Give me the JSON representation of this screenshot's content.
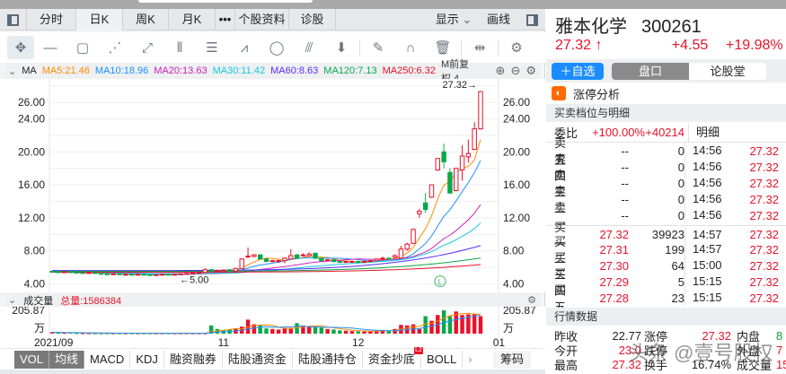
{
  "tabs": [
    "分时",
    "日K",
    "周K",
    "月K",
    "•••",
    "个股资料",
    "诊股"
  ],
  "tabs_right": {
    "display": "显示",
    "draw": "画线"
  },
  "active_tab": "日K",
  "ma_legend": {
    "label": "MA",
    "items": [
      {
        "text": "MA5:21.46",
        "color": "#ff8a00"
      },
      {
        "text": "MA10:18.96",
        "color": "#1e90ff"
      },
      {
        "text": "MA20:13.63",
        "color": "#d01fb8"
      },
      {
        "text": "MA30:11.42",
        "color": "#18c8e0"
      },
      {
        "text": "MA60:8.63",
        "color": "#5a2cff"
      },
      {
        "text": "MA120:7.13",
        "color": "#0aa84a"
      },
      {
        "text": "MA250:6.32",
        "color": "#e8122a"
      }
    ],
    "overlap": "M前复权.4"
  },
  "chart_data": {
    "type": "candlestick",
    "price_axis": {
      "ticks": [
        "4.00",
        "8.00",
        "12.00",
        "16.00",
        "20.00",
        "24.00",
        "26.00"
      ],
      "range": [
        3.6,
        28.2
      ]
    },
    "annotations": {
      "high": "27.32→",
      "low": "←5.00"
    },
    "x_labels": [
      {
        "text": "2021/09",
        "index": 0
      },
      {
        "text": "11",
        "index": 28
      },
      {
        "text": "12",
        "index": 50
      },
      {
        "text": "01",
        "index": 73
      }
    ],
    "ohlc": [
      [
        5.5,
        5.6,
        5.4,
        5.45
      ],
      [
        5.45,
        5.5,
        5.3,
        5.35
      ],
      [
        5.35,
        5.5,
        5.3,
        5.45
      ],
      [
        5.45,
        5.5,
        5.35,
        5.4
      ],
      [
        5.4,
        5.45,
        5.3,
        5.35
      ],
      [
        5.35,
        5.4,
        5.2,
        5.25
      ],
      [
        5.25,
        5.4,
        5.2,
        5.35
      ],
      [
        5.35,
        5.4,
        5.2,
        5.25
      ],
      [
        5.25,
        5.3,
        5.15,
        5.2
      ],
      [
        5.2,
        5.3,
        5.1,
        5.15
      ],
      [
        5.15,
        5.25,
        5.1,
        5.2
      ],
      [
        5.2,
        5.25,
        5.05,
        5.1
      ],
      [
        5.1,
        5.2,
        5.0,
        5.15
      ],
      [
        5.15,
        5.2,
        5.0,
        5.05
      ],
      [
        5.05,
        5.2,
        5.0,
        5.15
      ],
      [
        5.15,
        5.25,
        5.0,
        5.1
      ],
      [
        5.1,
        5.2,
        5.0,
        5.05
      ],
      [
        5.05,
        5.15,
        5.0,
        5.1
      ],
      [
        5.1,
        5.2,
        5.05,
        5.15
      ],
      [
        5.15,
        5.25,
        5.05,
        5.1
      ],
      [
        5.1,
        5.2,
        5.05,
        5.15
      ],
      [
        5.15,
        5.25,
        5.1,
        5.2
      ],
      [
        5.2,
        5.3,
        5.15,
        5.25
      ],
      [
        5.25,
        5.35,
        5.2,
        5.3
      ],
      [
        5.3,
        5.45,
        5.25,
        5.4
      ],
      [
        5.4,
        5.9,
        5.35,
        5.7
      ],
      [
        5.7,
        5.8,
        5.5,
        5.55
      ],
      [
        5.55,
        5.7,
        5.45,
        5.6
      ],
      [
        5.6,
        5.75,
        5.5,
        5.65
      ],
      [
        5.7,
        5.8,
        5.5,
        5.55
      ],
      [
        5.55,
        5.9,
        5.5,
        5.85
      ],
      [
        5.85,
        7.1,
        5.8,
        7.0
      ],
      [
        7.3,
        8.4,
        7.1,
        7.35
      ],
      [
        7.3,
        7.6,
        7.2,
        7.5
      ],
      [
        7.5,
        7.55,
        6.9,
        7.0
      ],
      [
        7.0,
        7.1,
        6.6,
        6.7
      ],
      [
        6.7,
        6.9,
        6.6,
        6.8
      ],
      [
        6.7,
        6.9,
        6.5,
        6.8
      ],
      [
        6.8,
        7.2,
        6.5,
        7.1
      ],
      [
        7.0,
        8.2,
        6.9,
        7.4
      ],
      [
        7.5,
        7.6,
        7.0,
        7.1
      ],
      [
        7.4,
        7.7,
        7.3,
        7.5
      ],
      [
        7.4,
        7.8,
        7.3,
        7.6
      ],
      [
        7.7,
        7.7,
        7.0,
        7.1
      ],
      [
        7.1,
        7.2,
        6.7,
        6.8
      ],
      [
        6.8,
        7.0,
        6.7,
        6.9
      ],
      [
        6.9,
        7.0,
        6.6,
        6.7
      ],
      [
        6.7,
        6.8,
        6.5,
        6.6
      ],
      [
        6.6,
        6.8,
        6.5,
        6.7
      ],
      [
        6.7,
        6.8,
        6.6,
        6.7
      ],
      [
        6.7,
        6.8,
        6.5,
        6.6
      ],
      [
        6.6,
        6.8,
        6.5,
        6.7
      ],
      [
        6.7,
        6.9,
        6.6,
        6.8
      ],
      [
        6.8,
        7.1,
        6.7,
        7.0
      ],
      [
        7.0,
        7.3,
        6.8,
        7.1
      ],
      [
        7.1,
        7.2,
        6.9,
        7.0
      ],
      [
        7.2,
        7.6,
        7.1,
        7.4
      ],
      [
        7.1,
        8.6,
        7.0,
        8.2
      ],
      [
        8.2,
        9.0,
        8.0,
        8.8
      ],
      [
        8.9,
        10.7,
        8.8,
        10.6
      ],
      [
        12.5,
        13.1,
        12.0,
        12.8
      ],
      [
        13.8,
        15.0,
        12.6,
        13.0
      ],
      [
        14.5,
        16.0,
        14.4,
        16.0
      ],
      [
        17.8,
        19.2,
        17.7,
        19.2
      ],
      [
        20.0,
        21.0,
        18.0,
        18.8
      ],
      [
        17.5,
        18.0,
        15.0,
        15.0
      ],
      [
        15.3,
        18.0,
        15.2,
        18.0
      ],
      [
        17.8,
        20.8,
        16.5,
        19.5
      ],
      [
        19.4,
        21.5,
        18.7,
        19.8
      ],
      [
        20.3,
        23.6,
        20.2,
        22.8
      ],
      [
        22.8,
        27.32,
        22.7,
        27.32
      ]
    ],
    "volume_unit": "万",
    "volume_max": "205.87",
    "volume": [
      12,
      10,
      6,
      8,
      5,
      4,
      4,
      3,
      3,
      3,
      3,
      3,
      3,
      3,
      3,
      3,
      3,
      3,
      3,
      3,
      3,
      3,
      3,
      3,
      3,
      3,
      70,
      40,
      30,
      35,
      40,
      60,
      120,
      80,
      70,
      45,
      40,
      35,
      45,
      50,
      90,
      70,
      60,
      60,
      55,
      40,
      35,
      28,
      25,
      22,
      20,
      18,
      20,
      25,
      30,
      25,
      40,
      75,
      70,
      80,
      40,
      150,
      110,
      160,
      200,
      150,
      190,
      160,
      165,
      170,
      150
    ],
    "volume_up": [
      1,
      0,
      1,
      0,
      0,
      1,
      1,
      0,
      0,
      0,
      1,
      0,
      1,
      0,
      1,
      0,
      0,
      1,
      1,
      0,
      1,
      1,
      1,
      1,
      1,
      1,
      0,
      0,
      0,
      0,
      1,
      1,
      1,
      1,
      0,
      0,
      1,
      1,
      1,
      1,
      0,
      1,
      1,
      0,
      0,
      1,
      0,
      0,
      1,
      1,
      0,
      1,
      1,
      1,
      1,
      0,
      1,
      1,
      1,
      1,
      1,
      0,
      1,
      1,
      0,
      0,
      1,
      1,
      1,
      1,
      1
    ]
  },
  "volume_header": {
    "label": "成交量",
    "total": "总量:1586384"
  },
  "bottom_tabs": [
    "VOL",
    "均线",
    "MACD",
    "KDJ",
    "融资融券",
    "陆股通资金",
    "陆股通持仓",
    "资金抄底",
    "BOLL"
  ],
  "bottom_badge": "L2",
  "chips_button": "筹码",
  "stock": {
    "name": "雅本化学",
    "code": "300261",
    "price": "27.32",
    "arrow": "↑",
    "change": "+4.55",
    "pct": "+19.98%"
  },
  "buttons": {
    "add": "＋自选",
    "seg_active": "盘口",
    "seg_other": "论股堂"
  },
  "limit_analysis": "涨停分析",
  "orderbook": {
    "title": "买卖档位与明细",
    "wb_label": "委比",
    "wb_pct": "+100.00%",
    "wb_diff": "+40214",
    "detail_label": "明细",
    "sells": [
      {
        "l": "卖五",
        "p": "--",
        "v": "0"
      },
      {
        "l": "卖四",
        "p": "--",
        "v": "0"
      },
      {
        "l": "卖三",
        "p": "--",
        "v": "0"
      },
      {
        "l": "卖二",
        "p": "--",
        "v": "0"
      },
      {
        "l": "卖一",
        "p": "--",
        "v": "0"
      }
    ],
    "buys": [
      {
        "l": "买一",
        "p": "27.32",
        "v": "39923"
      },
      {
        "l": "买二",
        "p": "27.31",
        "v": "199"
      },
      {
        "l": "买三",
        "p": "27.30",
        "v": "64"
      },
      {
        "l": "买四",
        "p": "27.29",
        "v": "5"
      },
      {
        "l": "买五",
        "p": "27.28",
        "v": "23"
      }
    ],
    "ticks": [
      {
        "t": "14:56",
        "p": "27.32"
      },
      {
        "t": "14:56",
        "p": "27.32"
      },
      {
        "t": "14:56",
        "p": "27.32"
      },
      {
        "t": "14:56",
        "p": "27.32"
      },
      {
        "t": "14:56",
        "p": "27.32"
      },
      {
        "t": "14:57",
        "p": "27.32"
      },
      {
        "t": "14:57",
        "p": "27.32"
      },
      {
        "t": "15:00",
        "p": "27.32"
      },
      {
        "t": "15:15",
        "p": "27.32"
      },
      {
        "t": "15:15",
        "p": "27.32"
      }
    ]
  },
  "market": {
    "title": "行情数据",
    "rows": [
      {
        "a": "昨收",
        "av": "22.77",
        "b": "涨停",
        "bv": "27.32",
        "c": "内盘",
        "cv": "8"
      },
      {
        "a": "今开",
        "av": "23.0",
        "b": "跌停",
        "bv": "",
        "c": "外盘",
        "cv": "7"
      },
      {
        "a": "最高",
        "av": "27.32",
        "b": "换手",
        "bv": "16.74%",
        "c": "成交量",
        "cv": "15"
      }
    ]
  },
  "watermark": "头条 @壹号股权"
}
